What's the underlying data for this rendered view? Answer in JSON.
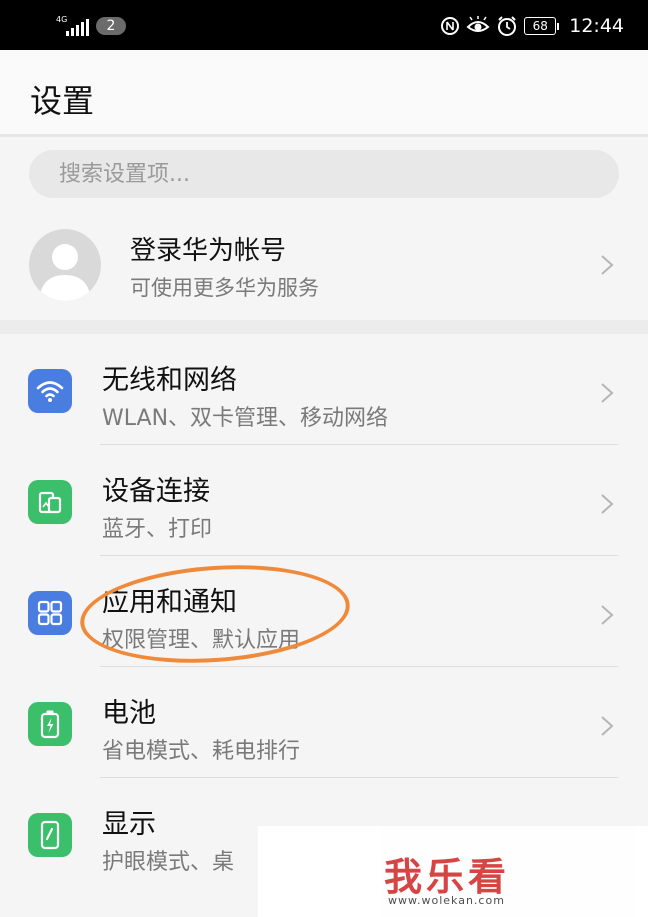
{
  "status_bar": {
    "network": "4G",
    "badge": "2",
    "battery": "68",
    "time": "12:44"
  },
  "header": {
    "title": "设置"
  },
  "search": {
    "placeholder": "搜索设置项..."
  },
  "account": {
    "title": "登录华为帐号",
    "subtitle": "可使用更多华为服务"
  },
  "settings": [
    {
      "title": "无线和网络",
      "subtitle": "WLAN、双卡管理、移动网络",
      "icon": "wifi-icon",
      "color": "#4a7de0"
    },
    {
      "title": "设备连接",
      "subtitle": "蓝牙、打印",
      "icon": "device-connection-icon",
      "color": "#3bbf6a"
    },
    {
      "title": "应用和通知",
      "subtitle": "权限管理、默认应用",
      "icon": "apps-grid-icon",
      "color": "#4a7de0"
    },
    {
      "title": "电池",
      "subtitle": "省电模式、耗电排行",
      "icon": "battery-icon",
      "color": "#3bbf6a"
    },
    {
      "title": "显示",
      "subtitle": "护眼模式、桌",
      "icon": "display-icon",
      "color": "#3bbf6a"
    }
  ],
  "annotation": {
    "color": "#f08a3b"
  },
  "watermark": {
    "text": "我乐看",
    "url": "www.wolekan.com"
  }
}
